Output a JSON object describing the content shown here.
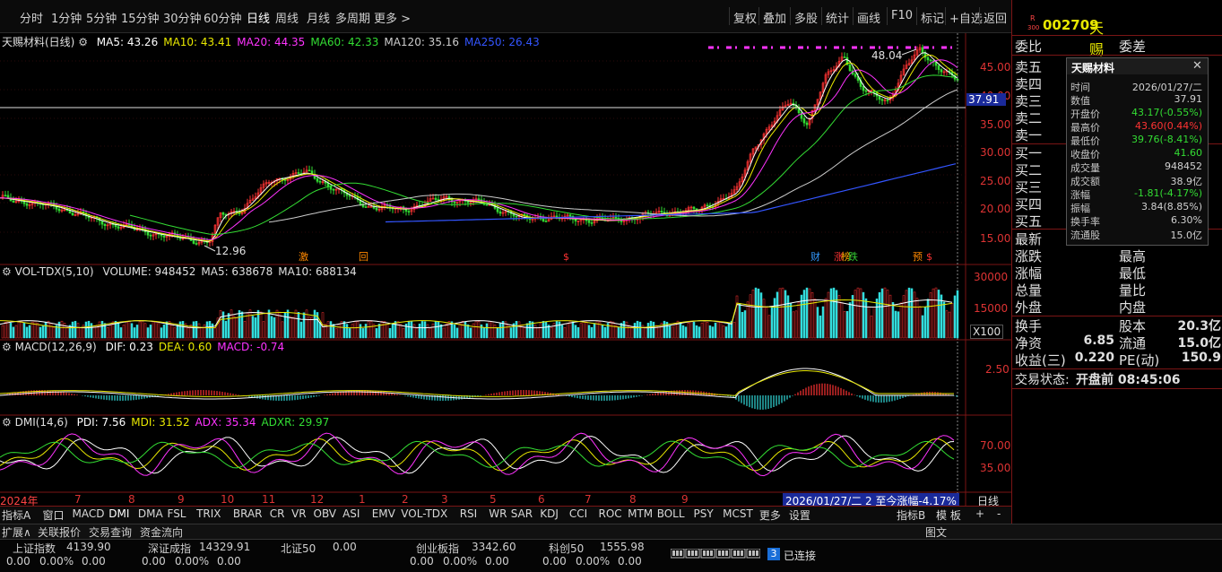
{
  "toolbar": {
    "periods": [
      "分时",
      "1分钟",
      "5分钟",
      "15分钟",
      "30分钟",
      "60分钟",
      "日线",
      "周线",
      "月线",
      "多周期",
      "更多 >"
    ],
    "right_buttons": [
      "复权",
      "叠加",
      "多股",
      "统计",
      "画线",
      "F10",
      "标记",
      "+自选",
      "返回"
    ]
  },
  "stock": {
    "badge_top": "R",
    "badge_bottom": "300",
    "code": "002709",
    "name": "天赐材料"
  },
  "main_indicator": {
    "title": "天赐材料(日线)",
    "items": [
      {
        "label": "MA5: 43.26",
        "color": "#ffffff"
      },
      {
        "label": "MA10: 43.41",
        "color": "#e8e800"
      },
      {
        "label": "MA20: 44.35",
        "color": "#ff33ff"
      },
      {
        "label": "MA60: 42.33",
        "color": "#33dd33"
      },
      {
        "label": "MA120: 35.16",
        "color": "#cccccc"
      },
      {
        "label": "MA250: 26.43",
        "color": "#3355ff"
      }
    ],
    "ticks": [
      "45.00",
      "40.00",
      "35.00",
      "30.00",
      "25.00",
      "20.00",
      "15.00"
    ],
    "high_label": "48.04",
    "low_label": "12.96",
    "crosshair_value": "37.91",
    "events": [
      {
        "t": "激",
        "c": "#ff8800"
      },
      {
        "t": "回",
        "c": "#ff8800"
      },
      {
        "t": "$",
        "c": "#ff3333"
      },
      {
        "t": "财",
        "c": "#3399ff"
      },
      {
        "t": "涨",
        "c": "#ff3333"
      },
      {
        "t": "榜",
        "c": "#ffaa00"
      },
      {
        "t": "跌",
        "c": "#33cc33"
      },
      {
        "t": "预",
        "c": "#ff8800"
      },
      {
        "t": "$",
        "c": "#ff3333"
      }
    ]
  },
  "vol_indicator": {
    "title": "VOL-TDX(5,10)",
    "items": [
      {
        "label": "VOLUME: 948452",
        "color": "#e0e0e0"
      },
      {
        "label": "MA5: 638678",
        "color": "#e0e0e0"
      },
      {
        "label": "MA10: 688134",
        "color": "#e0e0e0"
      }
    ],
    "ticks": [
      "30000",
      "15000"
    ],
    "unit": "X100"
  },
  "macd_indicator": {
    "title": "MACD(12,26,9)",
    "items": [
      {
        "label": "DIF: 0.23",
        "color": "#ffffff"
      },
      {
        "label": "DEA: 0.60",
        "color": "#e8e800"
      },
      {
        "label": "MACD: -0.74",
        "color": "#ff33ff"
      }
    ],
    "ticks": [
      "2.50"
    ]
  },
  "dmi_indicator": {
    "title": "DMI(14,6)",
    "items": [
      {
        "label": "PDI: 7.56",
        "color": "#ffffff"
      },
      {
        "label": "MDI: 31.52",
        "color": "#e8e800"
      },
      {
        "label": "ADX: 35.34",
        "color": "#ff33ff"
      },
      {
        "label": "ADXR: 29.97",
        "color": "#33dd33"
      }
    ],
    "ticks": [
      "70.00",
      "35.00"
    ]
  },
  "date_axis": {
    "labels": [
      "2024年",
      "7",
      "8",
      "9",
      "10",
      "11",
      "12",
      "1",
      "2",
      "3",
      "5",
      "6",
      "7",
      "8",
      "9"
    ],
    "cursor": "2026/01/27/二 2 至今涨幅-4.17%",
    "period": "日线"
  },
  "bottom_tabs": [
    "指标A",
    "窗口",
    "MACD",
    "DMI",
    "DMA",
    "FSL",
    "TRIX",
    "BRAR",
    "CR",
    "VR",
    "OBV",
    "ASI",
    "EMV",
    "VOL-TDX",
    "RSI",
    "WR",
    "SAR",
    "KDJ",
    "CCI",
    "ROC",
    "MTM",
    "BOLL",
    "PSY",
    "MCST",
    "更多",
    "设置"
  ],
  "bottom_right_tabs": [
    "指标B",
    "模 板",
    "+",
    "-"
  ],
  "footer_tabs": [
    "扩展∧",
    "关联报价",
    "交易查询",
    "资金流向"
  ],
  "footer_right": "图文",
  "indices": [
    {
      "name": "上证指数",
      "value": "4139.90",
      "chg": "0.00",
      "pct": "0.00%",
      "amt": "0.00"
    },
    {
      "name": "深证成指",
      "value": "14329.91",
      "chg": "0.00",
      "pct": "0.00%",
      "amt": "0.00"
    },
    {
      "name": "北证50",
      "value": "0.00",
      "chg": "",
      "pct": "",
      "amt": ""
    },
    {
      "name": "创业板指",
      "value": "3342.60",
      "chg": "0.00",
      "pct": "0.00%",
      "amt": "0.00"
    },
    {
      "name": "科创50",
      "value": "1555.98",
      "chg": "0.00",
      "pct": "0.00%",
      "amt": "0.00"
    }
  ],
  "connection": {
    "count": "3",
    "label": "已连接"
  },
  "right_panel": {
    "weibi": "委比",
    "weicha": "委差",
    "sell": [
      "卖五",
      "卖四",
      "卖三",
      "卖二",
      "卖一"
    ],
    "buy": [
      "买一",
      "买二",
      "买三",
      "买四",
      "买五"
    ],
    "stats": [
      [
        "最新",
        "",
        ""
      ],
      [
        "涨跌",
        "最高",
        ""
      ],
      [
        "涨幅",
        "最低",
        ""
      ],
      [
        "总量",
        "量比",
        ""
      ],
      [
        "外盘",
        "内盘",
        ""
      ]
    ],
    "fund": [
      {
        "l": "换手",
        "v": "",
        "l2": "股本",
        "v2": "20.3亿"
      },
      {
        "l": "净资",
        "v": "6.85",
        "l2": "流通",
        "v2": "15.0亿"
      },
      {
        "l": "收益(三)",
        "v": "0.220",
        "l2": "PE(动)",
        "v2": "150.9"
      }
    ],
    "status_label": "交易状态:",
    "status_value": "开盘前 08:45:06"
  },
  "popup": {
    "title": "天赐材料",
    "rows": [
      {
        "l": "时间",
        "v": "2026/01/27/二",
        "c": "#d0d0d0"
      },
      {
        "l": "数值",
        "v": "37.91",
        "c": "#d0d0d0"
      },
      {
        "l": "开盘价",
        "v": "43.17(-0.55%)",
        "c": "#33dd33"
      },
      {
        "l": "最高价",
        "v": "43.60(0.44%)",
        "c": "#ff3333"
      },
      {
        "l": "最低价",
        "v": "39.76(-8.41%)",
        "c": "#33dd33"
      },
      {
        "l": "收盘价",
        "v": "41.60",
        "c": "#33dd33"
      },
      {
        "l": "成交量",
        "v": "948452",
        "c": "#d0d0d0"
      },
      {
        "l": "成交额",
        "v": "38.9亿",
        "c": "#d0d0d0"
      },
      {
        "l": "涨幅",
        "v": "-1.81(-4.17%)",
        "c": "#33dd33"
      },
      {
        "l": "振幅",
        "v": "3.84(8.85%)",
        "c": "#d0d0d0"
      },
      {
        "l": "换手率",
        "v": "6.30%",
        "c": "#d0d0d0"
      },
      {
        "l": "流通股",
        "v": "15.0亿",
        "c": "#d0d0d0"
      }
    ]
  },
  "colors": {
    "up": "#ff3333",
    "down": "#33dd33",
    "border": "#7a1515",
    "ma250": "#3355ff"
  }
}
